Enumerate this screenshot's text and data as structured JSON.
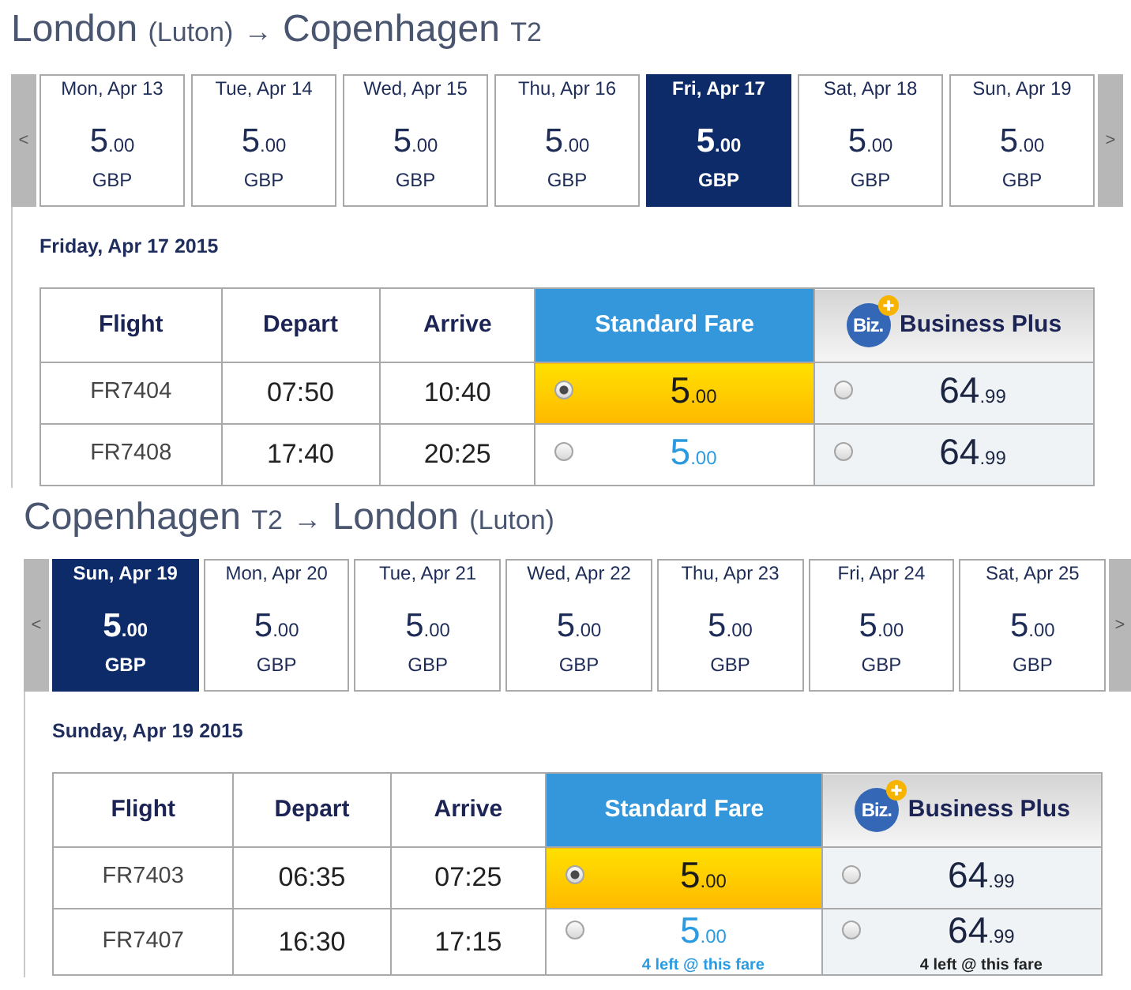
{
  "journeys": [
    {
      "title": [
        {
          "kind": "city",
          "text": "London"
        },
        {
          "kind": "detail",
          "text": "(Luton)"
        },
        {
          "kind": "arrow",
          "text": "→"
        },
        {
          "kind": "city",
          "text": "Copenhagen"
        },
        {
          "kind": "detail",
          "text": "T2"
        }
      ],
      "date_strip": {
        "previous": "<",
        "next": ">",
        "days": [
          {
            "label": "Mon, Apr 13",
            "amount": "5",
            "fraction": ".00",
            "currency": "GBP",
            "selected": false
          },
          {
            "label": "Tue, Apr 14",
            "amount": "5",
            "fraction": ".00",
            "currency": "GBP",
            "selected": false
          },
          {
            "label": "Wed, Apr 15",
            "amount": "5",
            "fraction": ".00",
            "currency": "GBP",
            "selected": false
          },
          {
            "label": "Thu, Apr 16",
            "amount": "5",
            "fraction": ".00",
            "currency": "GBP",
            "selected": false
          },
          {
            "label": "Fri, Apr 17",
            "amount": "5",
            "fraction": ".00",
            "currency": "GBP",
            "selected": true
          },
          {
            "label": "Sat, Apr 18",
            "amount": "5",
            "fraction": ".00",
            "currency": "GBP",
            "selected": false
          },
          {
            "label": "Sun, Apr 19",
            "amount": "5",
            "fraction": ".00",
            "currency": "GBP",
            "selected": false
          }
        ]
      },
      "date_heading": "Friday, Apr 17 2015",
      "table": {
        "columns": [
          "Flight",
          "Depart",
          "Arrive"
        ],
        "fare_classes": [
          {
            "kind": "standard",
            "label": "Standard Fare"
          },
          {
            "kind": "business",
            "label": "Business Plus",
            "logo": "Biz."
          }
        ],
        "rows": [
          {
            "flight": "FR7404",
            "depart": "07:50",
            "arrive": "10:40",
            "fares": [
              {
                "amount": "5",
                "fraction": ".00",
                "selected": true
              },
              {
                "amount": "64",
                "fraction": ".99",
                "selected": false
              }
            ]
          },
          {
            "flight": "FR7408",
            "depart": "17:40",
            "arrive": "20:25",
            "fares": [
              {
                "amount": "5",
                "fraction": ".00",
                "selected": false
              },
              {
                "amount": "64",
                "fraction": ".99",
                "selected": false
              }
            ]
          }
        ]
      }
    },
    {
      "title": [
        {
          "kind": "city",
          "text": "Copenhagen"
        },
        {
          "kind": "detail",
          "text": "T2"
        },
        {
          "kind": "arrow",
          "text": "→"
        },
        {
          "kind": "city",
          "text": "London"
        },
        {
          "kind": "detail",
          "text": "(Luton)"
        }
      ],
      "date_strip": {
        "previous": "<",
        "next": ">",
        "days": [
          {
            "label": "Sun, Apr 19",
            "amount": "5",
            "fraction": ".00",
            "currency": "GBP",
            "selected": true
          },
          {
            "label": "Mon, Apr 20",
            "amount": "5",
            "fraction": ".00",
            "currency": "GBP",
            "selected": false
          },
          {
            "label": "Tue, Apr 21",
            "amount": "5",
            "fraction": ".00",
            "currency": "GBP",
            "selected": false
          },
          {
            "label": "Wed, Apr 22",
            "amount": "5",
            "fraction": ".00",
            "currency": "GBP",
            "selected": false
          },
          {
            "label": "Thu, Apr 23",
            "amount": "5",
            "fraction": ".00",
            "currency": "GBP",
            "selected": false
          },
          {
            "label": "Fri, Apr 24",
            "amount": "5",
            "fraction": ".00",
            "currency": "GBP",
            "selected": false
          },
          {
            "label": "Sat, Apr 25",
            "amount": "5",
            "fraction": ".00",
            "currency": "GBP",
            "selected": false
          }
        ]
      },
      "date_heading": "Sunday, Apr 19 2015",
      "table": {
        "columns": [
          "Flight",
          "Depart",
          "Arrive"
        ],
        "fare_classes": [
          {
            "kind": "standard",
            "label": "Standard Fare"
          },
          {
            "kind": "business",
            "label": "Business Plus",
            "logo": "Biz."
          }
        ],
        "rows": [
          {
            "flight": "FR7403",
            "depart": "06:35",
            "arrive": "07:25",
            "fares": [
              {
                "amount": "5",
                "fraction": ".00",
                "selected": true
              },
              {
                "amount": "64",
                "fraction": ".99",
                "selected": false
              }
            ]
          },
          {
            "flight": "FR7407",
            "depart": "16:30",
            "arrive": "17:15",
            "fares": [
              {
                "amount": "5",
                "fraction": ".00",
                "selected": false,
                "note": "4 left @ this fare"
              },
              {
                "amount": "64",
                "fraction": ".99",
                "selected": false,
                "note": "4 left @ this fare"
              }
            ]
          }
        ]
      }
    }
  ]
}
